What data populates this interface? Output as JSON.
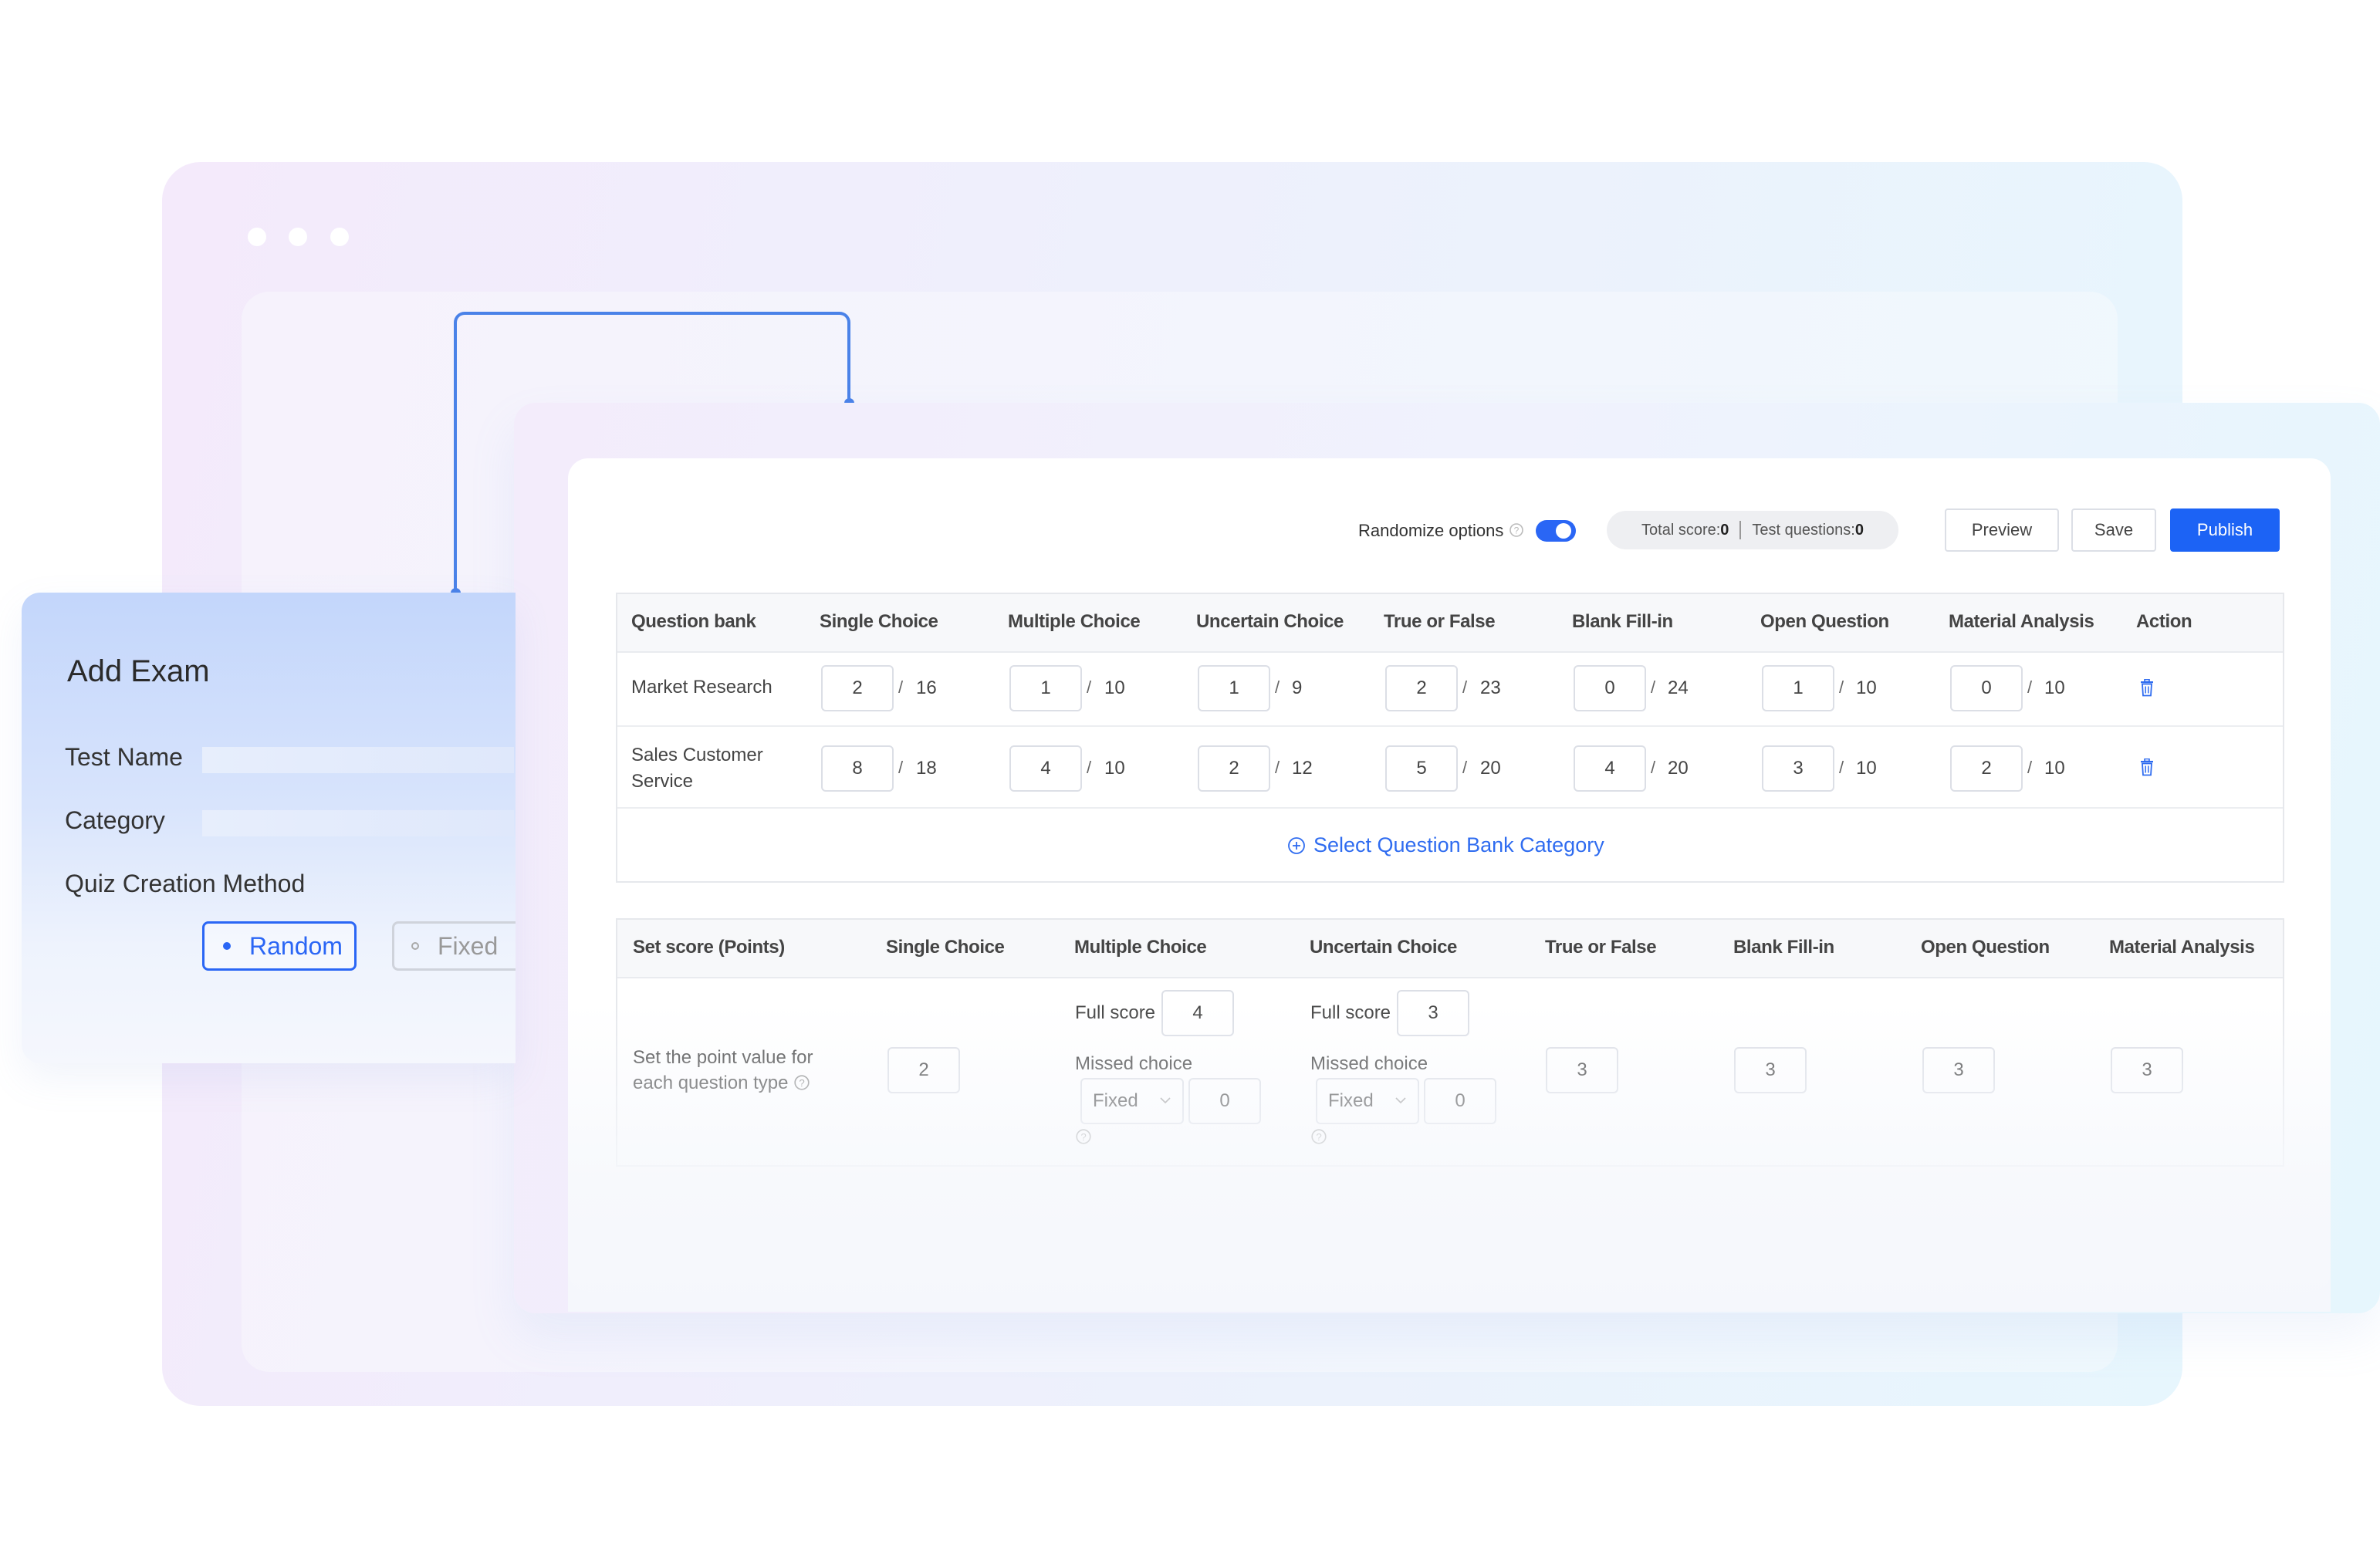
{
  "window": {
    "dots": 3
  },
  "toolbar": {
    "randomize_label": "Randomize options",
    "help_icon": "question-circle-icon",
    "toggle_on": true,
    "total_score_label": "Total score:",
    "total_score_value": "0",
    "test_questions_label": "Test questions:",
    "test_questions_value": "0",
    "preview_label": "Preview",
    "save_label": "Save",
    "publish_label": "Publish"
  },
  "question_table": {
    "headers": [
      "Question bank",
      "Single Choice",
      "Multiple Choice",
      "Uncertain Choice",
      "True or False",
      "Blank Fill-in",
      "Open Question",
      "Material Analysis",
      "Action"
    ],
    "rows": [
      {
        "bank": "Market Research",
        "cells": [
          {
            "value": "2",
            "total": "16"
          },
          {
            "value": "1",
            "total": "10"
          },
          {
            "value": "1",
            "total": "9"
          },
          {
            "value": "2",
            "total": "23"
          },
          {
            "value": "0",
            "total": "24"
          },
          {
            "value": "1",
            "total": "10"
          },
          {
            "value": "0",
            "total": "10"
          }
        ]
      },
      {
        "bank": "Sales Customer Service",
        "cells": [
          {
            "value": "8",
            "total": "18"
          },
          {
            "value": "4",
            "total": "10"
          },
          {
            "value": "2",
            "total": "12"
          },
          {
            "value": "5",
            "total": "20"
          },
          {
            "value": "4",
            "total": "20"
          },
          {
            "value": "3",
            "total": "10"
          },
          {
            "value": "2",
            "total": "10"
          }
        ]
      }
    ],
    "select_category_label": "Select Question Bank Category",
    "slash": "/"
  },
  "score_table": {
    "headers": [
      "Set score (Points)",
      "Single Choice",
      "Multiple Choice",
      "Uncertain Choice",
      "True or False",
      "Blank Fill-in",
      "Open Question",
      "Material Analysis"
    ],
    "row_label": "Set the point value for each question type",
    "single_choice": "2",
    "multiple_choice": {
      "full_score_label": "Full score",
      "full_score": "4",
      "missed_label": "Missed choice",
      "mode": "Fixed",
      "missed_value": "0"
    },
    "uncertain_choice": {
      "full_score_label": "Full score",
      "full_score": "3",
      "missed_label": "Missed choice",
      "mode": "Fixed",
      "missed_value": "0"
    },
    "true_false": "3",
    "blank_fill": "3",
    "open_question": "3",
    "material_analysis": "3"
  },
  "add_exam": {
    "title": "Add Exam",
    "test_name_label": "Test Name",
    "category_label": "Category",
    "method_label": "Quiz Creation Method",
    "random_label": "Random",
    "fixed_label": "Fixed",
    "selected": "Random"
  },
  "colors": {
    "primary": "#1c63f5",
    "connector": "#4a82e8"
  }
}
